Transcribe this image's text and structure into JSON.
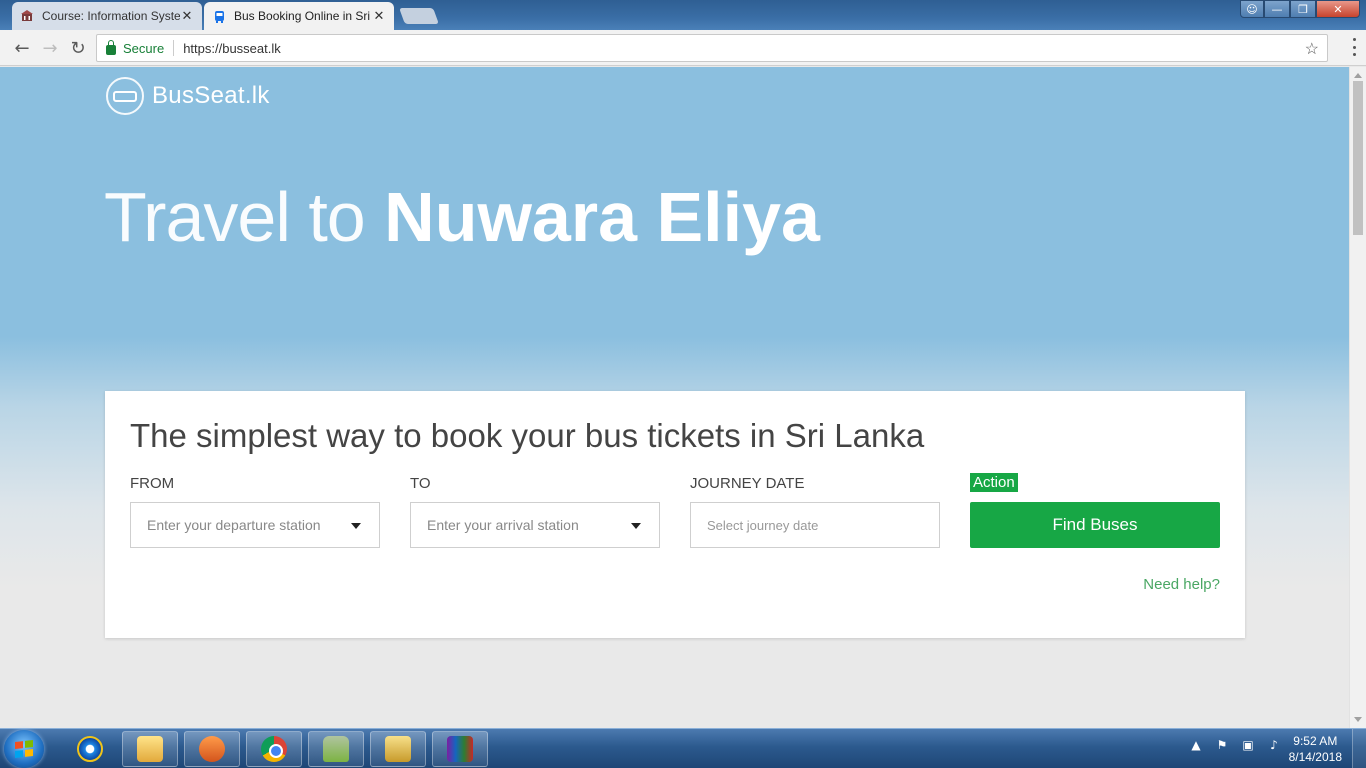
{
  "browser": {
    "tabs": [
      {
        "title": "Course: Information Syste",
        "active": false,
        "favicon": "university-icon"
      },
      {
        "title": "Bus Booking Online in Sri",
        "active": true,
        "favicon": "bus-icon"
      }
    ],
    "security_label": "Secure",
    "url": "https://busseat.lk"
  },
  "site": {
    "logo_text": "BusSeat.lk",
    "hero_prefix": "Travel to",
    "hero_destination": "Nuwara Eliya",
    "card_heading": "The simplest way to book your bus tickets in Sri Lanka",
    "from_label": "FROM",
    "from_placeholder": "Enter your departure station",
    "to_label": "TO",
    "to_placeholder": "Enter your arrival station",
    "date_label": "JOURNEY DATE",
    "date_placeholder": "Select journey date",
    "action_label": "Action",
    "find_button": "Find Buses",
    "help_link": "Need help?",
    "accent_color": "#17a745",
    "hero_bg_color": "#8bbfdf"
  },
  "taskbar": {
    "pinned": [
      "internet-explorer-icon",
      "file-explorer-icon",
      "media-player-icon",
      "chrome-icon",
      "android-sdk-icon",
      "tools-icon",
      "winrar-icon"
    ],
    "time": "9:52 AM",
    "date": "8/14/2018"
  }
}
